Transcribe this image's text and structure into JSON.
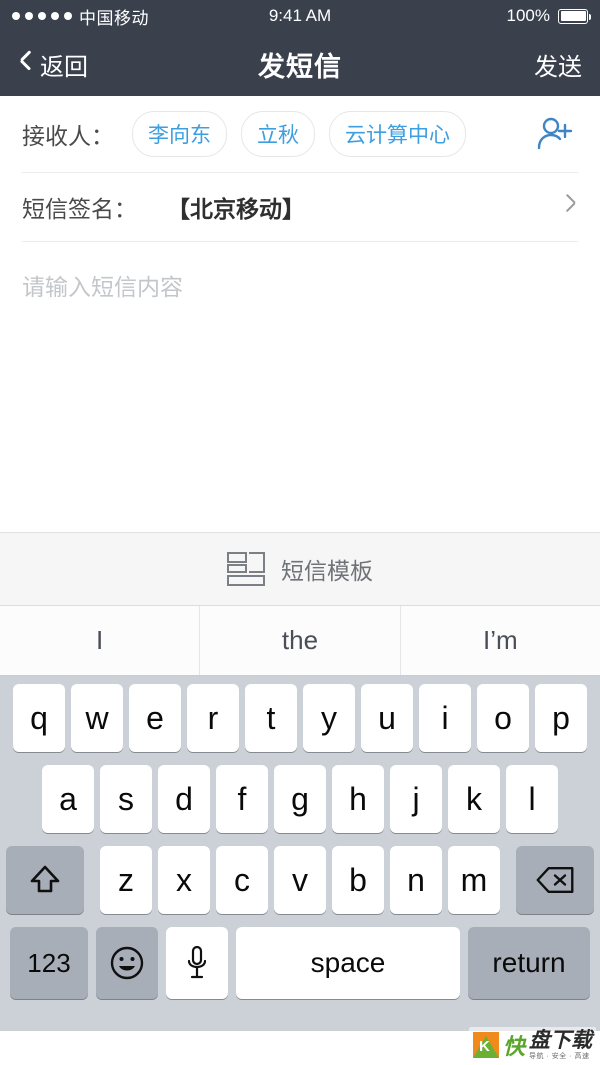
{
  "status_bar": {
    "signal_dots": 5,
    "carrier": "中国移动",
    "time": "9:41 AM",
    "battery_percent": "100%"
  },
  "nav_bar": {
    "back_label": "返回",
    "title": "发短信",
    "send_label": "发送"
  },
  "form": {
    "recipients_label": "接收人：",
    "recipients": [
      {
        "name": "李向东"
      },
      {
        "name": "立秋"
      },
      {
        "name": "云计算中心"
      }
    ],
    "add_person_icon": "person-add-icon",
    "signature_label": "短信签名：",
    "signature_value": "【北京移动】",
    "signature_chevron_icon": "chevron-right-icon"
  },
  "compose": {
    "placeholder": "请输入短信内容",
    "value": ""
  },
  "template_bar": {
    "icon": "sms-template-icon",
    "label": "短信模板"
  },
  "suggestions": [
    "I",
    "the",
    "I’m"
  ],
  "keyboard": {
    "row1": [
      "q",
      "w",
      "e",
      "r",
      "t",
      "y",
      "u",
      "i",
      "o",
      "p"
    ],
    "row2": [
      "a",
      "s",
      "d",
      "f",
      "g",
      "h",
      "j",
      "k",
      "l"
    ],
    "row3": [
      "z",
      "x",
      "c",
      "v",
      "b",
      "n",
      "m"
    ],
    "shift_icon": "shift-icon",
    "backspace_icon": "backspace-icon",
    "num_label": "123",
    "emoji_icon": "emoji-smiley-icon",
    "mic_icon": "microphone-icon",
    "space_label": "space",
    "return_label": "return"
  },
  "watermark": {
    "logo_letter": "K",
    "brand_green": "快",
    "brand_dark": "盘下载",
    "tagline": "导航 · 安全 · 高速"
  },
  "colors": {
    "nav_background": "#3a414d",
    "accent_blue": "#3d9ee0",
    "keyboard_background": "#ccd0d7",
    "key_white": "#ffffff",
    "key_gray": "#a8aeb8",
    "placeholder_gray": "#c3c6ca"
  }
}
